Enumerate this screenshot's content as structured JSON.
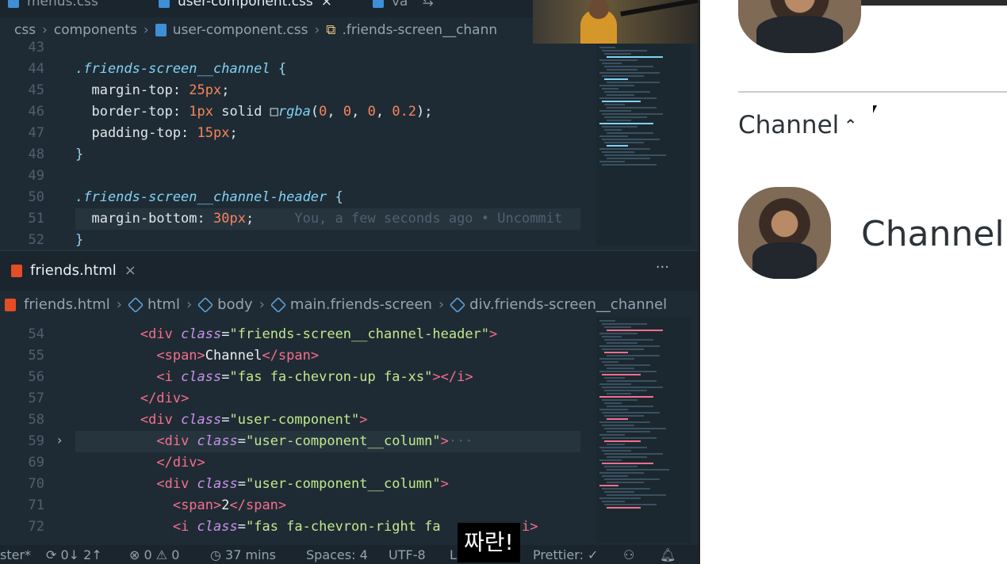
{
  "top_tabs": [
    {
      "label": "menus.css",
      "active": false
    },
    {
      "label": "user-component.css",
      "active": true
    },
    {
      "label": "va",
      "active": false
    }
  ],
  "css_breadcrumb": [
    "css",
    "components",
    "user-component.css",
    ".friends-screen__chann"
  ],
  "css_lines": [
    {
      "n": "43",
      "parts": []
    },
    {
      "n": "44",
      "parts": [
        {
          "c": "sel",
          "t": ".friends-screen__channel"
        },
        {
          "c": "brace",
          "t": " {"
        }
      ]
    },
    {
      "n": "45",
      "parts": [
        {
          "c": "prop",
          "t": "  margin-top: "
        },
        {
          "c": "num",
          "t": "25px"
        },
        {
          "c": "prop",
          "t": ";"
        }
      ]
    },
    {
      "n": "46",
      "parts": [
        {
          "c": "prop",
          "t": "  border-top: "
        },
        {
          "c": "num",
          "t": "1px"
        },
        {
          "c": "prop",
          "t": " solid "
        },
        {
          "c": "prop",
          "t": "□"
        },
        {
          "c": "sel",
          "t": "rgba"
        },
        {
          "c": "prop",
          "t": "("
        },
        {
          "c": "num",
          "t": "0"
        },
        {
          "c": "prop",
          "t": ", "
        },
        {
          "c": "num",
          "t": "0"
        },
        {
          "c": "prop",
          "t": ", "
        },
        {
          "c": "num",
          "t": "0"
        },
        {
          "c": "prop",
          "t": ", "
        },
        {
          "c": "num",
          "t": "0.2"
        },
        {
          "c": "prop",
          "t": ");"
        }
      ]
    },
    {
      "n": "47",
      "parts": [
        {
          "c": "prop",
          "t": "  padding-top: "
        },
        {
          "c": "num",
          "t": "15px"
        },
        {
          "c": "prop",
          "t": ";"
        }
      ]
    },
    {
      "n": "48",
      "parts": [
        {
          "c": "brace",
          "t": "}"
        }
      ]
    },
    {
      "n": "49",
      "parts": []
    },
    {
      "n": "50",
      "parts": [
        {
          "c": "sel",
          "t": ".friends-screen__channel-header"
        },
        {
          "c": "brace",
          "t": " {"
        }
      ]
    },
    {
      "n": "51",
      "parts": [
        {
          "c": "prop",
          "t": "  margin-bottom: "
        },
        {
          "c": "num",
          "t": "30px"
        },
        {
          "c": "prop",
          "t": ";"
        },
        {
          "c": "ghost",
          "t": "     You, a few seconds ago • Uncommit"
        }
      ]
    },
    {
      "n": "52",
      "parts": [
        {
          "c": "brace",
          "t": "}"
        }
      ]
    }
  ],
  "html_tab": {
    "label": "friends.html",
    "close": "×",
    "more": "···"
  },
  "html_breadcrumb": [
    "friends.html",
    "html",
    "body",
    "main.friends-screen",
    "div.friends-screen__channel"
  ],
  "html_lines": [
    {
      "n": "54",
      "parts": [
        {
          "c": "plain",
          "t": "        "
        },
        {
          "c": "tag",
          "t": "<div "
        },
        {
          "c": "attr",
          "t": "class"
        },
        {
          "c": "plain",
          "t": "="
        },
        {
          "c": "str",
          "t": "\"friends-screen__channel-header\""
        },
        {
          "c": "tag",
          "t": ">"
        }
      ]
    },
    {
      "n": "55",
      "parts": [
        {
          "c": "plain",
          "t": "          "
        },
        {
          "c": "tag",
          "t": "<span>"
        },
        {
          "c": "plain",
          "t": "Channel"
        },
        {
          "c": "tag",
          "t": "</span>"
        }
      ]
    },
    {
      "n": "56",
      "parts": [
        {
          "c": "plain",
          "t": "          "
        },
        {
          "c": "tag",
          "t": "<i "
        },
        {
          "c": "attr",
          "t": "class"
        },
        {
          "c": "plain",
          "t": "="
        },
        {
          "c": "str",
          "t": "\"fas fa-chevron-up fa-xs\""
        },
        {
          "c": "tag",
          "t": "></i>"
        }
      ]
    },
    {
      "n": "57",
      "parts": [
        {
          "c": "plain",
          "t": "        "
        },
        {
          "c": "tag",
          "t": "</div>"
        }
      ]
    },
    {
      "n": "58",
      "parts": [
        {
          "c": "plain",
          "t": "        "
        },
        {
          "c": "tag",
          "t": "<div "
        },
        {
          "c": "attr",
          "t": "class"
        },
        {
          "c": "plain",
          "t": "="
        },
        {
          "c": "str",
          "t": "\"user-component\""
        },
        {
          "c": "tag",
          "t": ">"
        }
      ]
    },
    {
      "n": "59",
      "parts": [
        {
          "c": "plain",
          "t": "          "
        },
        {
          "c": "tag",
          "t": "<div "
        },
        {
          "c": "attr",
          "t": "class"
        },
        {
          "c": "plain",
          "t": "="
        },
        {
          "c": "str",
          "t": "\"user-component__column\""
        },
        {
          "c": "tag",
          "t": ">"
        },
        {
          "c": "ghost",
          "t": "···"
        }
      ]
    },
    {
      "n": "69",
      "parts": [
        {
          "c": "plain",
          "t": "          "
        },
        {
          "c": "tag",
          "t": "</div>"
        }
      ]
    },
    {
      "n": "70",
      "parts": [
        {
          "c": "plain",
          "t": "          "
        },
        {
          "c": "tag",
          "t": "<div "
        },
        {
          "c": "attr",
          "t": "class"
        },
        {
          "c": "plain",
          "t": "="
        },
        {
          "c": "str",
          "t": "\"user-component__column\""
        },
        {
          "c": "tag",
          "t": ">"
        }
      ]
    },
    {
      "n": "71",
      "parts": [
        {
          "c": "plain",
          "t": "            "
        },
        {
          "c": "tag",
          "t": "<span>"
        },
        {
          "c": "plain",
          "t": "2"
        },
        {
          "c": "tag",
          "t": "</span>"
        }
      ]
    },
    {
      "n": "72",
      "parts": [
        {
          "c": "plain",
          "t": "            "
        },
        {
          "c": "tag",
          "t": "<i "
        },
        {
          "c": "attr",
          "t": "class"
        },
        {
          "c": "plain",
          "t": "="
        },
        {
          "c": "str",
          "t": "\"fas fa-chevron-right fa"
        },
        {
          "c": "plain",
          "t": "          "
        },
        {
          "c": "tag",
          "t": "i>"
        }
      ]
    }
  ],
  "status": {
    "branch": "ster*",
    "sync": "0↓ 2↑",
    "problems": "⊗ 0 ⚠ 0",
    "time": "37 mins",
    "spaces": "Spaces: 4",
    "encoding": "UTF-8",
    "ln": "Ln",
    "prettier": "Prettier: ✓"
  },
  "subtitle": "짜란!",
  "preview": {
    "channel_header": "Channel",
    "chevron": "⌃",
    "user_name": "Channel"
  },
  "colors": {
    "editor_bg": "#1f2b34",
    "tag": "#f56f8d",
    "string": "#c3e88d",
    "number": "#f7845b"
  }
}
